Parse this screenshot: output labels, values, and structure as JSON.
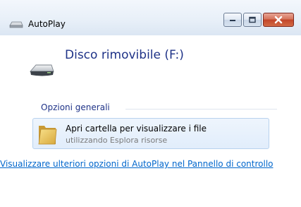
{
  "window": {
    "title": "AutoPlay",
    "icon": "autoplay-drive-icon",
    "buttons": {
      "minimize": "minimize-icon",
      "maximize": "maximize-icon",
      "close": "close-icon"
    }
  },
  "device": {
    "name": "Disco rimovibile (F:)",
    "icon": "removable-drive-icon"
  },
  "group": {
    "label": "Opzioni generali",
    "options": [
      {
        "title": "Apri cartella per visualizzare i file",
        "subtitle": "utilizzando Esplora risorse",
        "icon": "folder-icon"
      }
    ]
  },
  "footer_link": "Visualizzare ulteriori opzioni di AutoPlay nel Pannello di controllo",
  "colors": {
    "heading": "#1e3287",
    "link": "#0066cc",
    "close_button": "#c2452a"
  }
}
